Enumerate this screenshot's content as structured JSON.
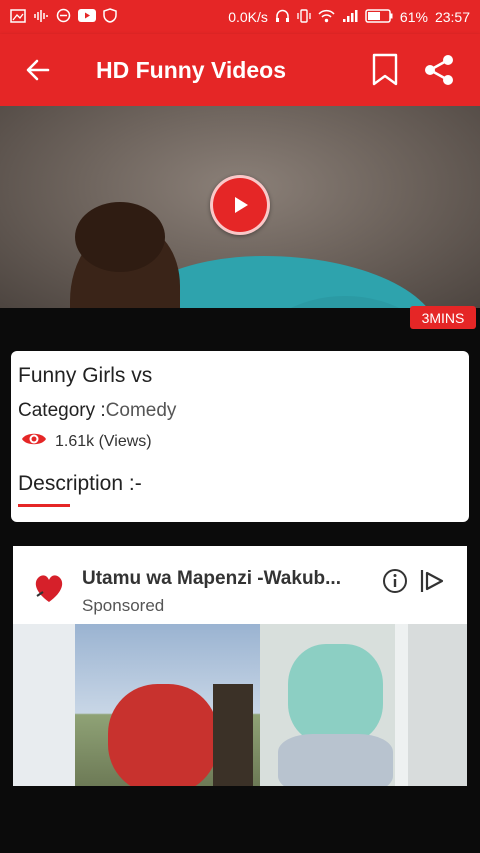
{
  "status_bar": {
    "speed": "0.0K/s",
    "battery": "61%",
    "time": "23:57"
  },
  "app_bar": {
    "title": "HD Funny Videos"
  },
  "video": {
    "duration_badge": "3MINS"
  },
  "info_card": {
    "title": "Funny Girls vs",
    "category_label": "Category :",
    "category_value": "Comedy",
    "views": "1.61k (Views)",
    "description_label": "Description :-"
  },
  "ad": {
    "title": "Utamu wa  Mapenzi -Wakub...",
    "sponsored": "Sponsored"
  },
  "colors": {
    "accent": "#e52626",
    "background": "#0b0b0b",
    "card": "#ffffff"
  }
}
